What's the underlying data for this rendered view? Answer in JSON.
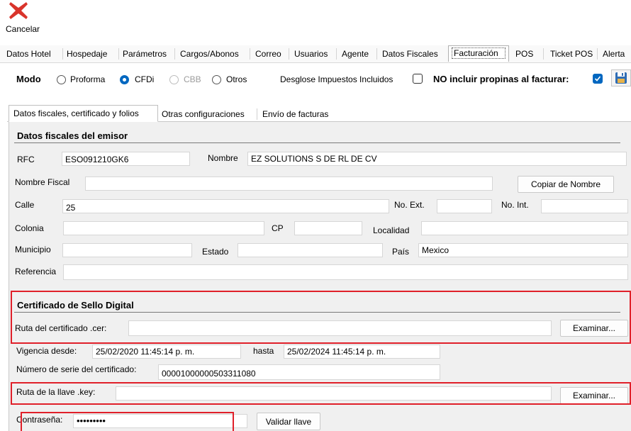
{
  "toolbar": {
    "cancel_label": "Cancelar"
  },
  "main_tabs": [
    "Datos Hotel",
    "Hospedaje",
    "Parámetros",
    "Cargos/Abonos",
    "Correo",
    "Usuarios",
    "Agente",
    "Datos Fiscales",
    "Facturación",
    "POS",
    "Ticket POS",
    "Alerta"
  ],
  "active_main_tab": "Facturación",
  "mode": {
    "label": "Modo",
    "options": [
      "Proforma",
      "CFDi",
      "CBB",
      "Otros"
    ],
    "selected": "CFDi",
    "disabled": [
      "CBB"
    ],
    "desglose_label": "Desglose Impuestos Incluidos",
    "desglose_checked": false,
    "no_propinas_label": "NO incluir propinas al facturar:",
    "no_propinas_checked": true,
    "save_icon": "save-icon"
  },
  "sub_tabs": [
    "Datos fiscales, certificado y folios",
    "Otras configuraciones",
    "Envío de facturas"
  ],
  "active_sub_tab": "Datos fiscales, certificado y folios",
  "emisor": {
    "title": "Datos fiscales del emisor",
    "rfc_label": "RFC",
    "rfc_value": "ESO091210GK6",
    "nombre_label": "Nombre",
    "nombre_value": "EZ SOLUTIONS S DE RL DE CV",
    "nombre_fiscal_label": "Nombre Fiscal",
    "nombre_fiscal_value": "",
    "copiar_button": "Copiar de Nombre",
    "calle_label": "Calle",
    "calle_value": "25",
    "noext_label": "No. Ext.",
    "noext_value": "",
    "noint_label": "No. Int.",
    "noint_value": "",
    "colonia_label": "Colonia",
    "colonia_value": "",
    "cp_label": "CP",
    "cp_value": "",
    "localidad_label": "Localidad",
    "localidad_value": "",
    "municipio_label": "Municipio",
    "municipio_value": "",
    "estado_label": "Estado",
    "estado_value": "",
    "pais_label": "País",
    "pais_value": "Mexico",
    "referencia_label": "Referencia",
    "referencia_value": ""
  },
  "certificado": {
    "title": "Certificado de Sello Digital",
    "ruta_cer_label": "Ruta del certificado .cer:",
    "ruta_cer_value": "",
    "examinar_label": "Examinar...",
    "vigencia_label": "Vigencia desde:",
    "vigencia_desde": "25/02/2020 11:45:14 p. m.",
    "hasta_label": "hasta",
    "vigencia_hasta": "25/02/2024 11:45:14 p. m.",
    "serie_label": "Número de serie del certificado:",
    "serie_value": "00001000000503311080",
    "ruta_key_label": "Ruta de la llave .key:",
    "ruta_key_value": "",
    "examinar_key_label": "Examinar...",
    "password_label": "Contraseña:",
    "password_value": "•••••••••",
    "validar_label": "Validar llave"
  },
  "colors": {
    "accent": "#0067c0",
    "highlight": "#e0202a",
    "cancel": "#d9342b"
  }
}
